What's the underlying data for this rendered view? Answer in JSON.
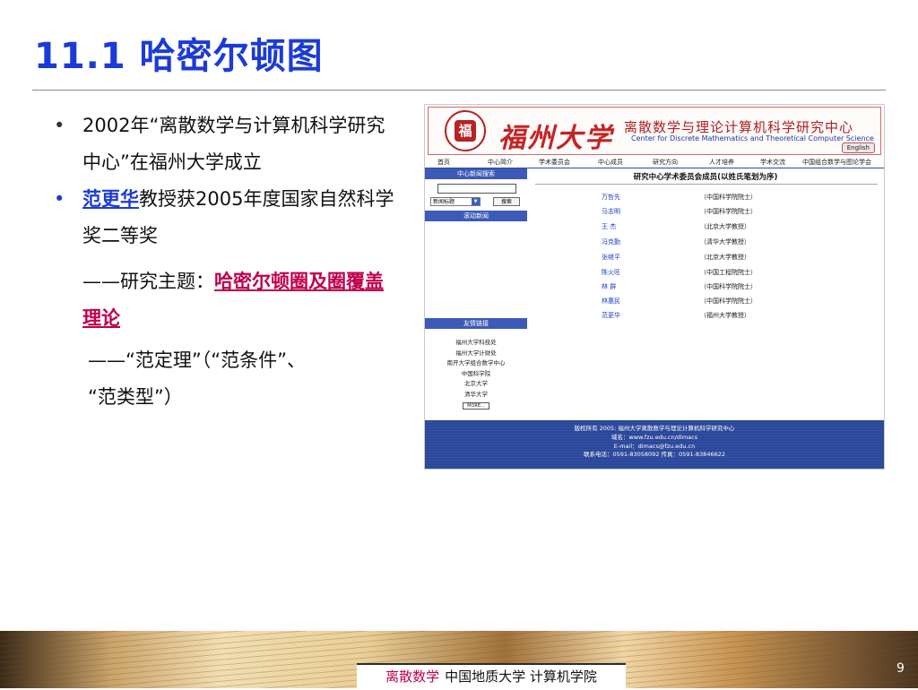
{
  "slide": {
    "title": "11.1 哈密尔顿图",
    "page_number": "9"
  },
  "bullets": [
    {
      "text": "2002年“离散数学与计算机科学研究中心”在福州大学成立"
    },
    {
      "link_name": "范更华",
      "text": "教授获2005年度国家自然科学奖二等奖"
    }
  ],
  "topic": {
    "lead": "——研究主题：",
    "link": "哈密尔顿圈及圈覆盖理论"
  },
  "fan_line": {
    "line1": "——“范定理”（“范条件”、",
    "line2": "“范类型”）"
  },
  "website": {
    "seal_char": "福",
    "calligraphy": "福州大学",
    "banner_cn": "离散数学与理论计算机科学研究中心",
    "banner_en": "Center for Discrete Mathematics and Theoretical Computer Science",
    "english_button": "English",
    "nav": [
      "首页",
      "中心简介",
      "学术委员会",
      "中心成员",
      "研究方向",
      "人才培养",
      "学术交流",
      "中国组合数学与图论学会"
    ],
    "news_search_title": "中心新闻搜索",
    "search_select": "新闻标题",
    "search_button": "搜索",
    "scroll_news_title": "滚动新闻",
    "friend_links_title": "友情链接",
    "friend_links": [
      "福州大学科技处",
      "福州大学计财处",
      "南开大学组合数学中心",
      "中国科学院",
      "北京大学",
      "清华大学"
    ],
    "more_button": "MORE...",
    "committee_title": "研究中心学术委员会成员(以姓氏笔划为序)",
    "members": [
      {
        "name": "万哲先",
        "affiliation": "（中国科学院院士）"
      },
      {
        "name": "马志明",
        "affiliation": "（中国科学院院士）"
      },
      {
        "name": "王  杰",
        "affiliation": "（北京大学教授）"
      },
      {
        "name": "冯克勤",
        "affiliation": "（清华大学教授）"
      },
      {
        "name": "张继平",
        "affiliation": "（北京大学教授）"
      },
      {
        "name": "陈火旺",
        "affiliation": "（中国工程院院士）"
      },
      {
        "name": "林  群",
        "affiliation": "（中国科学院院士）"
      },
      {
        "name": "林惠民",
        "affiliation": "（中国科学院院士）"
      },
      {
        "name": "范更华",
        "affiliation": "（福州大学教授）"
      }
    ],
    "footer": {
      "copyright": "版权所有 2005: 福州大学离散数学与理论计算机科学研究中心",
      "domain": "域名：www.fzu.edu.cn/dimacs",
      "email": "E-mail：dimacs@fzu.edu.cn",
      "phone": "联系电话：0591-83058092 传真：0591-83846622"
    }
  },
  "footer": {
    "course": "离散数学",
    "school": "中国地质大学 计算机学院"
  }
}
